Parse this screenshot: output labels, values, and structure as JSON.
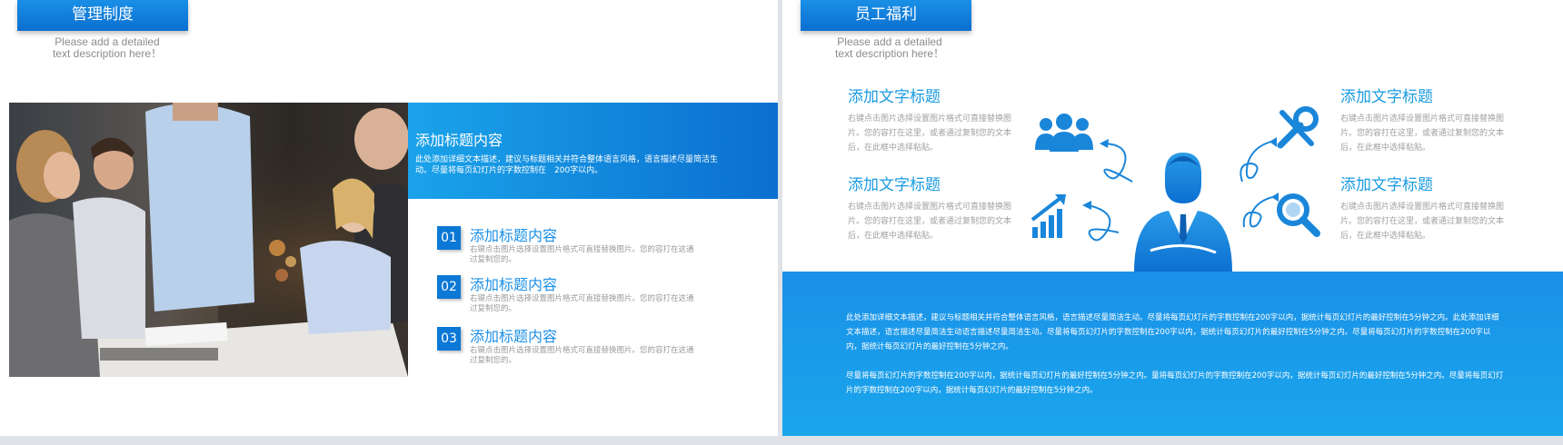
{
  "left_slide": {
    "title": "管理制度",
    "subtitle_line1": "Please add a detailed",
    "subtitle_line2": "text description here！",
    "panel": {
      "heading": "添加标题内容",
      "desc": "此处添加详细文本描述，建议与标题相关并符合整体语言风格，语言描述尽量简洁生动。尽量将每页幻灯片的字数控制在　200字以内。"
    },
    "items": [
      {
        "num": "01",
        "title": "添加标题内容",
        "desc": "右键点击图片选择设置图片格式可直接替换图片。您的容打在这通过复制您的。"
      },
      {
        "num": "02",
        "title": "添加标题内容",
        "desc": "右键点击图片选择设置图片格式可直接替换图片。您的容打在这通过复制您的。"
      },
      {
        "num": "03",
        "title": "添加标题内容",
        "desc": "右键点击图片选择设置图片格式可直接替换图片。您的容打在这通过复制您的。"
      }
    ]
  },
  "right_slide": {
    "title": "员工福利",
    "subtitle_line1": "Please add a detailed",
    "subtitle_line2": "text description here！",
    "blocks": [
      {
        "heading": "添加文字标题",
        "desc": "右键点击图片选择设置图片格式可直接替换图片。您的容打在这里，或者通过复制您的文本后，在此框中选择粘贴。"
      },
      {
        "heading": "添加文字标题",
        "desc": "右键点击图片选择设置图片格式可直接替换图片。您的容打在这里，或者通过复制您的文本后，在此框中选择粘贴。"
      },
      {
        "heading": "添加文字标题",
        "desc": "右键点击图片选择设置图片格式可直接替换图片。您的容打在这里，或者通过复制您的文本后，在此框中选择粘贴。"
      },
      {
        "heading": "添加文字标题",
        "desc": "右键点击图片选择设置图片格式可直接替换图片。您的容打在这里，或者通过复制您的文本后，在此框中选择粘贴。"
      }
    ],
    "band_para1": "此处添加详细文本描述，建议与标题相关并符合整体语言风格，语言描述尽量简洁生动。尽量将每页幻灯片的字数控制在200字以内，据统计每页幻灯片的最好控制在5分钟之内。此处添加详细文本描述，语言描述尽量简洁生动语言描述尽量简洁生动。尽量将每页幻灯片的字数控制在200字以内，据统计每页幻灯片的最好控制在5分钟之内。尽量将每页幻灯片的字数控制在200字以内，据统计每页幻灯片的最好控制在5分钟之内。",
    "band_para2": "尽量将每页幻灯片的字数控制在200字以内，据统计每页幻灯片的最好控制在5分钟之内。量将每页幻灯片的字数控制在200字以内，据统计每页幻灯片的最好控制在5分钟之内。尽量将每页幻灯片的字数控制在200字以内，据统计每页幻灯片的最好控制在5分钟之内。",
    "icons": [
      "team-icon",
      "tools-icon",
      "growth-chart-icon",
      "magnifier-icon",
      "businessman-icon",
      "arrow-icon"
    ]
  },
  "colors": {
    "accent": "#0b78d6",
    "accent_light": "#1aa3ea",
    "heading_blue": "#1a9be0",
    "muted_text": "#a0a0a0"
  }
}
